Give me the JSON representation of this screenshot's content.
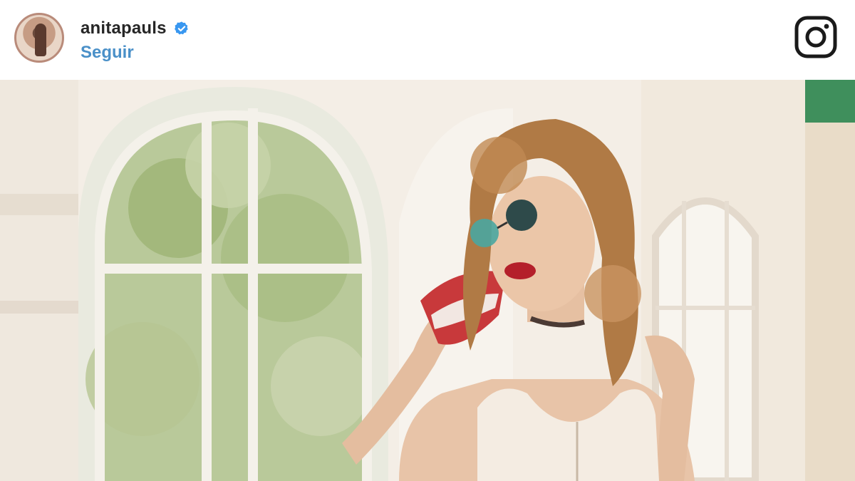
{
  "post": {
    "username": "anitapauls",
    "follow_label": "Seguir"
  },
  "icons": {
    "avatar": "profile-avatar",
    "verified": "verified-badge-icon",
    "brand": "instagram-icon"
  },
  "colors": {
    "follow_link": "#4a90c8",
    "verified_badge": "#3897f0",
    "username_text": "#262626"
  }
}
